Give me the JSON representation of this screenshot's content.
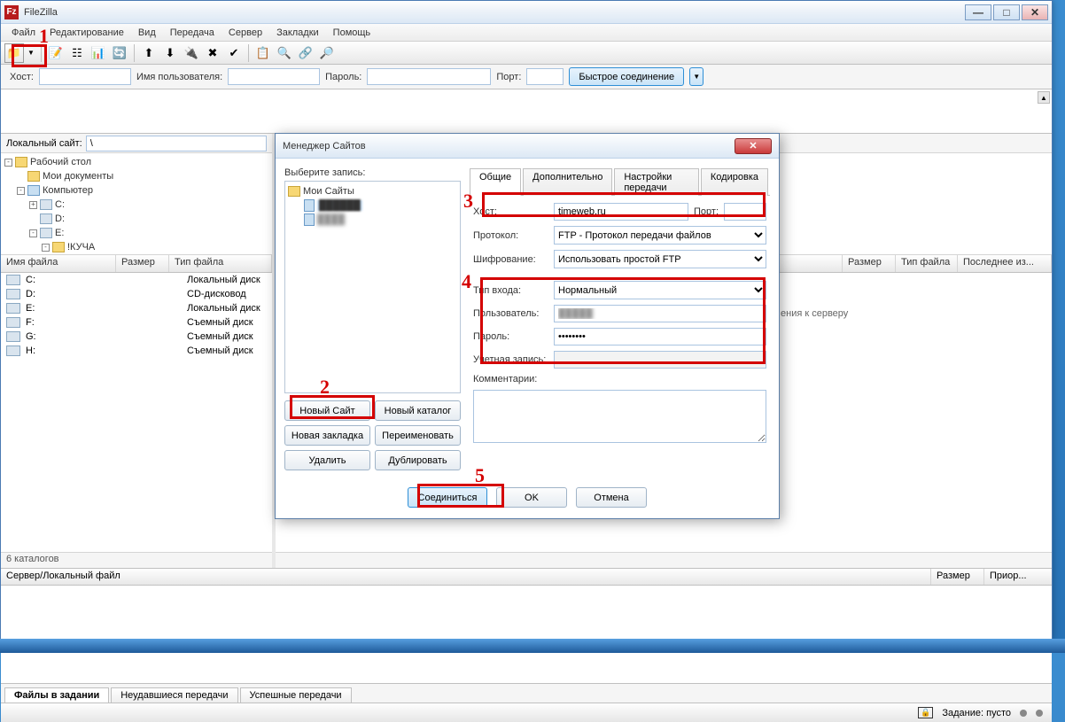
{
  "title": "FileZilla",
  "menu": {
    "file": "Файл",
    "edit": "Редактирование",
    "view": "Вид",
    "transfer": "Передача",
    "server": "Сервер",
    "bookmarks": "Закладки",
    "help": "Помощь"
  },
  "quickbar": {
    "host_label": "Хост:",
    "user_label": "Имя пользователя:",
    "pass_label": "Пароль:",
    "port_label": "Порт:",
    "connect": "Быстрое соединение"
  },
  "local": {
    "path_label": "Локальный сайт:",
    "path_value": "\\",
    "tree": {
      "desktop": "Рабочий стол",
      "docs": "Мои документы",
      "computer": "Компьютер",
      "c": "C:",
      "d": "D:",
      "e": "E:",
      "kucha": "!КУЧА"
    },
    "cols": {
      "name": "Имя файла",
      "size": "Размер",
      "type": "Тип файла"
    },
    "rows": [
      {
        "name": "C:",
        "type": "Локальный диск"
      },
      {
        "name": "D:",
        "type": "CD-дисковод"
      },
      {
        "name": "E:",
        "type": "Локальный диск"
      },
      {
        "name": "F:",
        "type": "Съемный диск"
      },
      {
        "name": "G:",
        "type": "Съемный диск"
      },
      {
        "name": "H:",
        "type": "Съемный диск"
      }
    ],
    "status": "6 каталогов"
  },
  "remote": {
    "cols": {
      "size": "Размер",
      "type": "Тип файла",
      "modified": "Последнее из..."
    },
    "empty_hint_suffix": "ения к серверу"
  },
  "queue": {
    "cols": {
      "server_local": "Сервер/Локальный файл",
      "size": "Размер",
      "prio": "Приор..."
    },
    "tabs": {
      "queued": "Файлы в задании",
      "failed": "Неудавшиеся передачи",
      "ok": "Успешные передачи"
    }
  },
  "statusbar": {
    "queue_label": "Задание: пусто"
  },
  "dialog": {
    "title": "Менеджер Сайтов",
    "select_label": "Выберите запись:",
    "sites_root": "Мои Сайты",
    "btns": {
      "new_site": "Новый Сайт",
      "new_dir": "Новый каталог",
      "new_bm": "Новая закладка",
      "rename": "Переименовать",
      "delete": "Удалить",
      "dup": "Дублировать",
      "connect": "Соединиться",
      "ok": "OK",
      "cancel": "Отмена"
    },
    "tabs": {
      "general": "Общие",
      "adv": "Дополнительно",
      "transfer": "Настройки передачи",
      "charset": "Кодировка"
    },
    "form": {
      "host_label": "Хост:",
      "host_value": "timeweb.ru",
      "port_label": "Порт:",
      "protocol_label": "Протокол:",
      "protocol_value": "FTP - Протокол передачи файлов",
      "encryption_label": "Шифрование:",
      "encryption_value": "Использовать простой FTP",
      "logon_label": "Тип входа:",
      "logon_value": "Нормальный",
      "user_label": "Пользователь:",
      "user_value": "",
      "pass_label": "Пароль:",
      "pass_value": "",
      "account_label": "Учетная запись:",
      "comments_label": "Комментарии:"
    }
  },
  "annotations": {
    "1": "1",
    "2": "2",
    "3": "3",
    "4": "4",
    "5": "5"
  }
}
